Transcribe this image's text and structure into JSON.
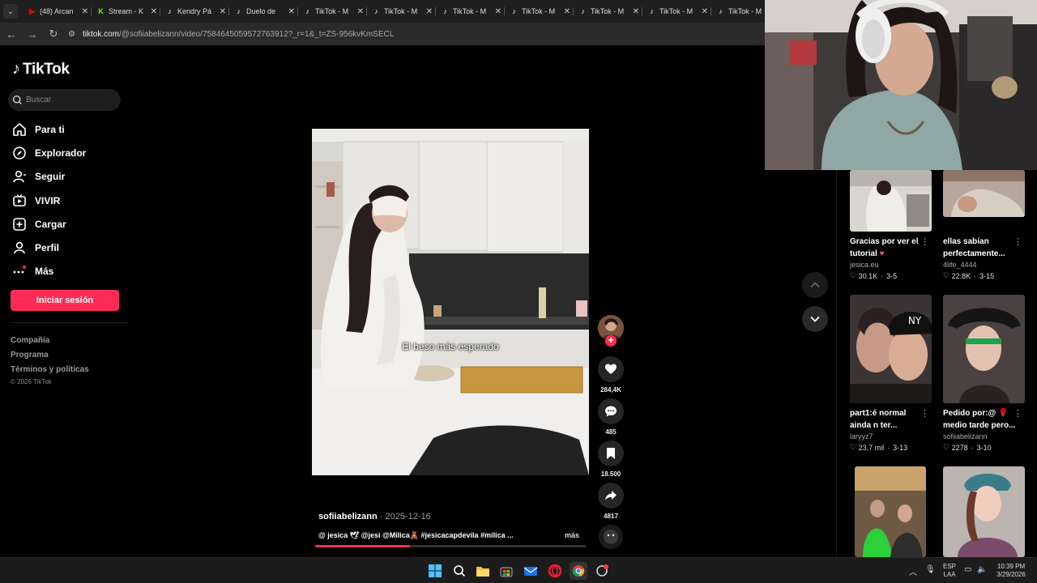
{
  "browser": {
    "tabs": [
      {
        "label": "(48) Arcan",
        "icon": "youtube-icon",
        "color": "#ff0000"
      },
      {
        "label": "Stream - K",
        "icon": "kick-icon",
        "color": "#53fc18"
      },
      {
        "label": "Kendry Pá",
        "icon": "tiktok-icon",
        "color": "#ffffff"
      },
      {
        "label": "Duelo de",
        "icon": "tiktok-icon",
        "color": "#ffffff"
      },
      {
        "label": "TikTok - M",
        "icon": "tiktok-icon",
        "color": "#ffffff"
      },
      {
        "label": "TikTok - M",
        "icon": "tiktok-icon",
        "color": "#ffffff"
      },
      {
        "label": "TikTok - M",
        "icon": "tiktok-icon",
        "color": "#ffffff"
      },
      {
        "label": "TikTok - M",
        "icon": "tiktok-icon",
        "color": "#ffffff"
      },
      {
        "label": "TikTok - M",
        "icon": "tiktok-icon",
        "color": "#ffffff"
      },
      {
        "label": "TikTok - M",
        "icon": "tiktok-icon",
        "color": "#ffffff"
      },
      {
        "label": "TikTok - M",
        "icon": "tiktok-icon",
        "color": "#ffffff"
      }
    ],
    "url_host": "tiktok.com",
    "url_path": "/@sofiiabelizann/video/7584645059572763912?_r=1&_t=ZS-956kvKmSECL"
  },
  "sidebar": {
    "logo": "TikTok",
    "search_placeholder": "Buscar",
    "nav": [
      {
        "label": "Para ti",
        "icon": "home-icon"
      },
      {
        "label": "Explorador",
        "icon": "compass-icon"
      },
      {
        "label": "Seguir",
        "icon": "following-icon"
      },
      {
        "label": "VIVIR",
        "icon": "live-icon"
      },
      {
        "label": "Cargar",
        "icon": "upload-icon"
      },
      {
        "label": "Perfil",
        "icon": "profile-icon"
      },
      {
        "label": "Más",
        "icon": "more-icon"
      }
    ],
    "login_label": "Iniciar sesión",
    "footer_links": [
      "Compañía",
      "Programa",
      "Términos y políticas"
    ],
    "copyright": "© 2026 TikTok"
  },
  "video": {
    "caption_overlay": "El beso más esperado",
    "author": "sofiiabelizann",
    "date": "2025-12-16",
    "description": "@ jesica 🕊 @jesi @Milica🧸 #jesicacapdevila #milica ...",
    "more_label": "más",
    "progress": 0.35,
    "likes": "284,4K",
    "comments": "485",
    "saves": "18.500",
    "shares": "4817"
  },
  "related": [
    {
      "title_lines": [
        "Gracias por ver el",
        "tutorial"
      ],
      "heart": "♥",
      "author": "jesica.eu",
      "likes": "30.1K",
      "date": "3-5"
    },
    {
      "title_lines": [
        "ellas sabían",
        "perfectamente..."
      ],
      "author": "4life_4444",
      "likes": "22.8K",
      "date": "3-15"
    },
    {
      "title_lines": [
        "part1:é normal",
        "ainda n ter..."
      ],
      "author": "laryyz7",
      "likes": "23,7 mil",
      "date": "3-13"
    },
    {
      "title_lines": [
        "Pedido por:@ 🌹",
        "medio tarde pero..."
      ],
      "author": "sofiiabelizann",
      "likes": "2278",
      "date": "3-10"
    },
    {
      "title_lines": [],
      "author": "",
      "likes": "",
      "date": ""
    },
    {
      "title_lines": [],
      "author": "",
      "likes": "",
      "date": ""
    }
  ],
  "taskbar": {
    "lang_top": "ESP",
    "lang_bottom": "LAA",
    "time": "10:39 PM",
    "date": "3/29/2026"
  },
  "colors": {
    "accent": "#fe2c55",
    "background": "#000000"
  }
}
